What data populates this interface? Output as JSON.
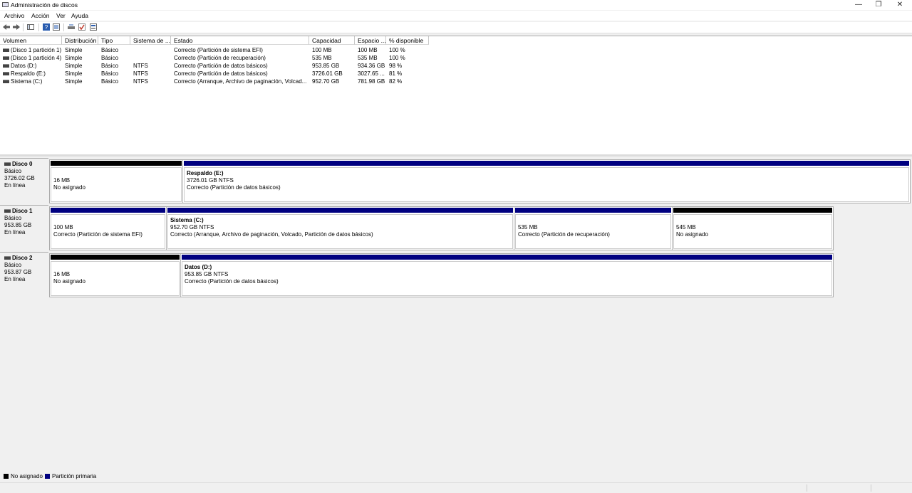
{
  "window": {
    "title": "Administración de discos",
    "min": "—",
    "restore": "❐",
    "close": "✕"
  },
  "menu": [
    "Archivo",
    "Acción",
    "Ver",
    "Ayuda"
  ],
  "toolbar_icons": [
    "back-arrow-icon",
    "forward-arrow-icon",
    "console-tree-icon",
    "help-icon",
    "properties-icon",
    "connect-drive-icon",
    "check-icon",
    "settings-icon"
  ],
  "volume_table": {
    "columns": [
      "Volumen",
      "Distribución",
      "Tipo",
      "Sistema de ...",
      "Estado",
      "Capacidad",
      "Espacio ...",
      "% disponible"
    ],
    "rows": [
      [
        "(Disco 1 partición 1)",
        "Simple",
        "Básico",
        "",
        "Correcto (Partición de sistema EFI)",
        "100 MB",
        "100 MB",
        "100 %"
      ],
      [
        "(Disco 1 partición 4)",
        "Simple",
        "Básico",
        "",
        "Correcto (Partición de recuperación)",
        "535 MB",
        "535 MB",
        "100 %"
      ],
      [
        "Datos (D:)",
        "Simple",
        "Básico",
        "NTFS",
        "Correcto (Partición de datos básicos)",
        "953.85 GB",
        "934.36 GB",
        "98 %"
      ],
      [
        "Respaldo (E:)",
        "Simple",
        "Básico",
        "NTFS",
        "Correcto (Partición de datos básicos)",
        "3726.01 GB",
        "3027.65 ...",
        "81 %"
      ],
      [
        "Sistema (C:)",
        "Simple",
        "Básico",
        "NTFS",
        "Correcto (Arranque, Archivo de paginación, Volcad...",
        "952.70 GB",
        "781.98 GB",
        "82 %"
      ]
    ]
  },
  "disks": [
    {
      "name": "Disco 0",
      "type": "Básico",
      "size": "3726.02 GB",
      "status": "En línea",
      "partitions": [
        {
          "kind": "unallocated",
          "title": "",
          "line1": "16 MB",
          "line2": "No asignado"
        },
        {
          "kind": "primary",
          "title": "Respaldo  (E:)",
          "line1": "3726.01 GB NTFS",
          "line2": "Correcto (Partición de datos básicos)"
        }
      ]
    },
    {
      "name": "Disco 1",
      "type": "Básico",
      "size": "953.85 GB",
      "status": "En línea",
      "partitions": [
        {
          "kind": "primary",
          "title": "",
          "line1": "100 MB",
          "line2": "Correcto (Partición de sistema EFI)"
        },
        {
          "kind": "primary",
          "title": "Sistema  (C:)",
          "line1": "952.70 GB NTFS",
          "line2": "Correcto (Arranque, Archivo de paginación, Volcado, Partición de datos básicos)"
        },
        {
          "kind": "primary",
          "title": "",
          "line1": "535 MB",
          "line2": "Correcto (Partición de recuperación)"
        },
        {
          "kind": "unallocated",
          "title": "",
          "line1": "545 MB",
          "line2": "No asignado"
        }
      ]
    },
    {
      "name": "Disco 2",
      "type": "Básico",
      "size": "953.87 GB",
      "status": "En línea",
      "partitions": [
        {
          "kind": "unallocated",
          "title": "",
          "line1": "16 MB",
          "line2": "No asignado"
        },
        {
          "kind": "primary",
          "title": "Datos  (D:)",
          "line1": "953.85 GB NTFS",
          "line2": "Correcto (Partición de datos básicos)"
        }
      ]
    }
  ],
  "legend": [
    {
      "label": "No asignado",
      "color": "#000000"
    },
    {
      "label": "Partición primaria",
      "color": "#000080"
    }
  ]
}
